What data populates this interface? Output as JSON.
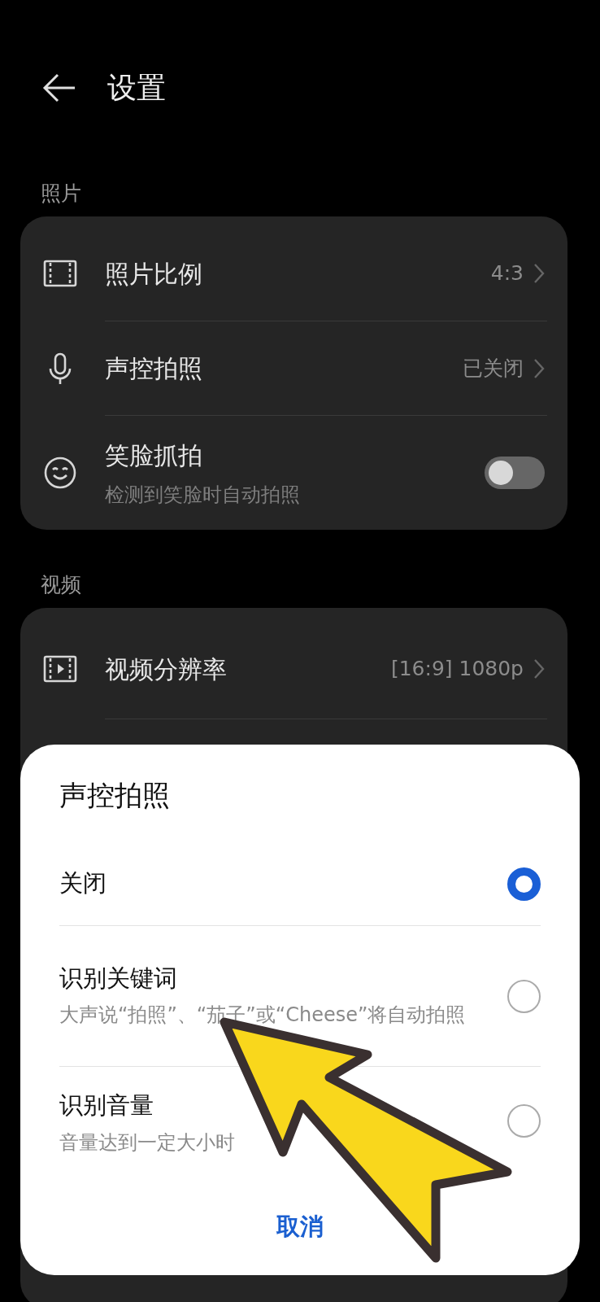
{
  "header": {
    "title": "设置"
  },
  "sections": [
    {
      "label": "照片",
      "rows": [
        {
          "kind": "link",
          "title": "照片比例",
          "value": "4:3"
        },
        {
          "kind": "link",
          "title": "声控拍照",
          "value": "已关闭"
        },
        {
          "kind": "toggle",
          "title": "笑脸抓拍",
          "subtitle": "检测到笑脸时自动拍照",
          "on": false
        }
      ]
    },
    {
      "label": "视频",
      "rows": [
        {
          "kind": "link",
          "title": "视频分辨率",
          "value": "[16:9] 1080p"
        }
      ]
    }
  ],
  "dialog": {
    "title": "声控拍照",
    "options": [
      {
        "label": "关闭",
        "selected": true
      },
      {
        "label": "识别关键词",
        "subtitle": "大声说“拍照”、“茄子”或“Cheese”将自动拍照",
        "selected": false
      },
      {
        "label": "识别音量",
        "subtitle": "音量达到一定大小时",
        "selected": false
      }
    ],
    "cancel": "取消"
  }
}
